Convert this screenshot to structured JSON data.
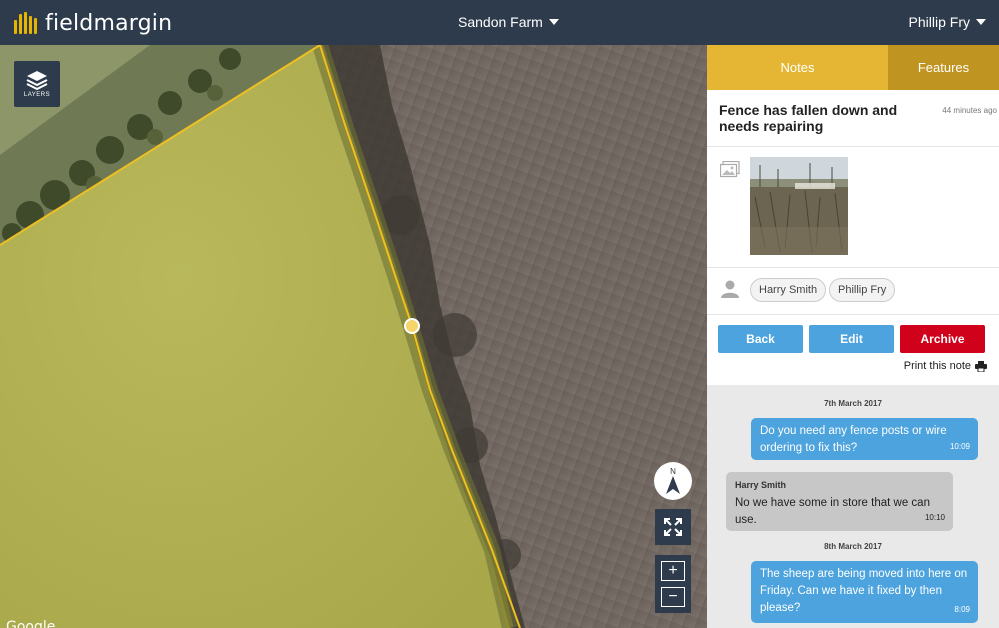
{
  "header": {
    "logo_text": "fieldmargin",
    "farm_name": "Sandon Farm",
    "user_name": "Phillip Fry"
  },
  "map": {
    "layers_label": "LAYERS",
    "compass_label": "N",
    "zoom_in": "+",
    "zoom_out": "−",
    "attribution": "Google"
  },
  "panel": {
    "tabs": [
      {
        "label": "Notes",
        "active": true
      },
      {
        "label": "Features",
        "active": false
      }
    ],
    "note": {
      "title": "Fence has fallen down and needs repairing",
      "time_ago": "44 minutes ago",
      "people": [
        "Harry Smith",
        "Phillip Fry"
      ]
    },
    "actions": {
      "back": "Back",
      "edit": "Edit",
      "archive": "Archive",
      "print": "Print this note"
    },
    "chat": [
      {
        "type": "date",
        "text": "7th March 2017"
      },
      {
        "type": "message",
        "from_me": true,
        "text": "Do you need any fence posts or wire ordering to fix this?",
        "time": "10:09"
      },
      {
        "type": "message",
        "from_me": false,
        "author": "Harry Smith",
        "text": "No we have some in store that we can use.",
        "time": "10:10"
      },
      {
        "type": "date",
        "text": "8th March 2017"
      },
      {
        "type": "message",
        "from_me": true,
        "text": "The sheep are being moved into here on Friday. Can we have it fixed by then please?",
        "time": "8:09"
      }
    ]
  },
  "colors": {
    "header_bg": "#2d3b4c",
    "accent_yellow": "#e4b634",
    "tab_features": "#c09420",
    "button_blue": "#4ca3dd",
    "archive_red": "#d0021b",
    "field_boundary": "#f0c020"
  }
}
